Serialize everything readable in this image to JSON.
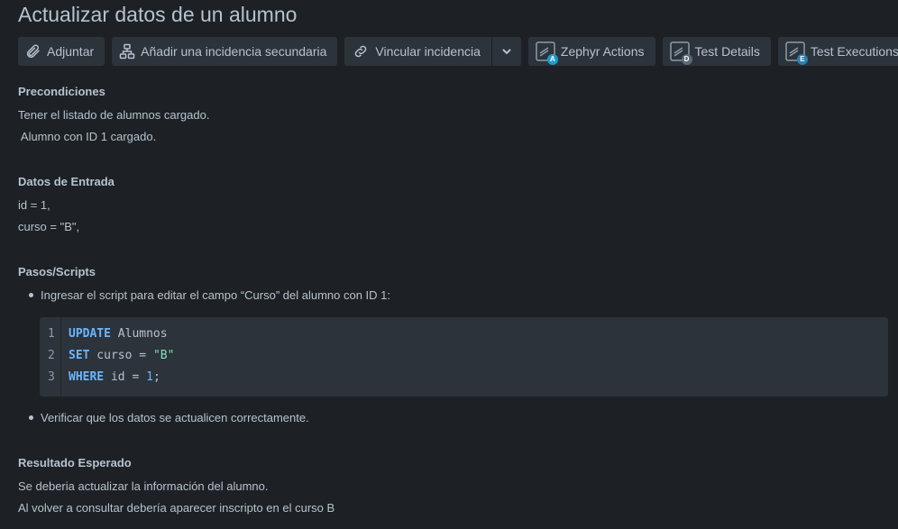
{
  "title": "Actualizar datos de un alumno",
  "toolbar": {
    "attach_label": "Adjuntar",
    "add_subtask_label": "Añadir una incidencia secundaria",
    "link_issue_label": "Vincular incidencia",
    "zephyr_actions_label": "Zephyr Actions",
    "zephyr_actions_badge": "A",
    "test_details_label": "Test Details",
    "test_details_badge": "D",
    "test_executions_label": "Test Executions",
    "test_executions_badge": "E"
  },
  "sections": {
    "preconditions": {
      "heading": "Precondiciones",
      "lines": [
        "Tener el listado de alumnos cargado.",
        " Alumno con ID 1 cargado."
      ]
    },
    "input_data": {
      "heading": "Datos de Entrada",
      "lines": [
        "id = 1,",
        "curso = \"B\","
      ]
    },
    "steps": {
      "heading": "Pasos/Scripts",
      "bullet_1": "Ingresar el script para editar el campo “Curso” del alumno con ID 1:",
      "code": {
        "line_numbers": [
          "1",
          "2",
          "3"
        ],
        "line_1": {
          "kw": "UPDATE",
          "rest": " Alumnos"
        },
        "line_2": {
          "kw": "SET",
          "mid": " curso = ",
          "str": "\"B\""
        },
        "line_3": {
          "kw": "WHERE",
          "mid": " id = ",
          "num": "1",
          "end": ";"
        }
      },
      "bullet_2": "Verificar que los datos se actualicen correctamente."
    },
    "expected": {
      "heading": "Resultado Esperado",
      "lines": [
        "Se deberia actualizar la información del alumno.",
        "Al volver a consultar debería aparecer inscripto en el curso B"
      ]
    }
  },
  "colors": {
    "background": "#1d2125",
    "button": "#2c333a",
    "text": "#b6c2cf",
    "keyword": "#6cb6ff",
    "string": "#7ee2b8",
    "badge_a": "#1d9bd1",
    "badge_d": "#5a6a7a",
    "badge_e": "#2a7fb0"
  }
}
